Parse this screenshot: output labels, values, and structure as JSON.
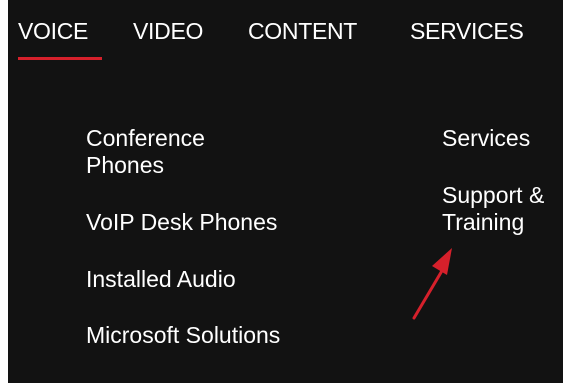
{
  "nav": {
    "items": [
      {
        "label": "VOICE"
      },
      {
        "label": "VIDEO"
      },
      {
        "label": "CONTENT"
      },
      {
        "label": "SERVICES"
      }
    ]
  },
  "menu": {
    "left": [
      {
        "label": "Conference Phones"
      },
      {
        "label": "VoIP Desk Phones"
      },
      {
        "label": "Installed Audio"
      },
      {
        "label": "Microsoft Solutions"
      }
    ],
    "right": [
      {
        "label": "Services"
      },
      {
        "label": "Support & Training"
      }
    ]
  },
  "colors": {
    "panel_bg": "#121212",
    "active_underline": "#d6202b",
    "annotation_arrow": "#d6202b"
  },
  "annotation": {
    "icon": "red-arrow-icon"
  }
}
